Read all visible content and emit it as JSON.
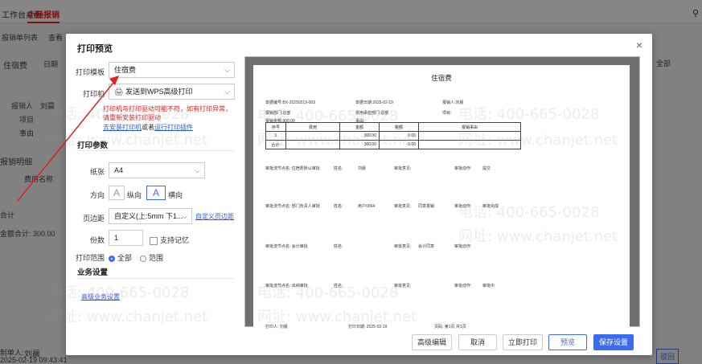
{
  "background": {
    "tabs": [
      "工作台桌面",
      "小畅报销"
    ],
    "sub_tabs": [
      "报销单列表",
      "查看"
    ],
    "left_labels": [
      "住宿费",
      "日期",
      "报销人",
      "项目",
      "事由"
    ],
    "reporter_name": "刘晨",
    "detail_heading": "报销明细",
    "detail_col_name": "费用名称",
    "detail_rows": [
      "合计"
    ],
    "total_text": "金额合计: 300.00",
    "footer_user_label": "制单人:",
    "footer_user": "刘晨",
    "footer_date": "2025-02-19 09:43:41",
    "right_btn": "驳回",
    "right_menu": "全部"
  },
  "dialog": {
    "title": "打印预览",
    "close": "×",
    "template_label": "打印模板",
    "template_value": "住宿费",
    "printer_label": "打印机",
    "printer_value": "发送到WPS高级打印",
    "error_line1": "打印机与打印驱动可能不符，如有打印异常，",
    "error_line2": "请重新安装打印驱动",
    "install_link1": "去安装打印机",
    "install_or": "或者",
    "install_link2": "运行打印插件",
    "print_params": "打印参数",
    "paper_label": "纸张",
    "paper_value": "A4",
    "orient_label": "方向",
    "portrait": "纵向",
    "landscape": "横向",
    "margin_label": "页边距",
    "margin_value": "自定义(上:5mm  下1...",
    "margin_link": "自定义页边距",
    "copies_label": "份数",
    "copies_value": "1",
    "collate": "支持记忆",
    "range_label": "打印范围",
    "range_all": "全部",
    "range_part": "范围",
    "business": "业务设置",
    "advanced_link": "高级业务设置",
    "buttons": [
      "高级编辑",
      "取消",
      "立即打印",
      "预览",
      "保存设置"
    ]
  },
  "doc": {
    "title": "住宿费",
    "no_label": "单据编号:",
    "no": "BX-20250219-003",
    "date_label": "单据日期:",
    "date": "2025-02-19",
    "person_label": "报销人:",
    "person": "刘晨",
    "dept_label": "报销部门:",
    "dept": "总部",
    "cost_dept_label": "费用承担部门:",
    "cost_dept": "总部",
    "project_label": "项目:",
    "amount_label": "报销金额:",
    "amount": "300.00",
    "reason_label": "事由:",
    "table_headers": [
      "序号",
      "费用",
      "金额",
      "税额",
      "报销事由"
    ],
    "table_rows": [
      [
        "1",
        "",
        "300.00",
        "0.00",
        ""
      ],
      [
        "合计:",
        "",
        "300.00",
        "0.00",
        ""
      ]
    ],
    "approvals": [
      {
        "node": "审批流节点名: 住宿费默认审批",
        "name": "姓名:",
        "person": "刘晨",
        "opinion": "审批意见:",
        "action": "审批动作:",
        "action_val": "提交"
      },
      {
        "node": "审批流节点名: 部门负责人审批",
        "name": "姓名:",
        "person": "用户0094",
        "opinion": "审批意见:",
        "opinion_val": "同意报销",
        "action": "审批动作:",
        "action_val": "审批完成"
      },
      {
        "node": "审批流节点名: 会计审批",
        "name": "姓名:",
        "person": "",
        "opinion": "审批意见:",
        "opinion_val": "会计同意",
        "action": "审批动作:",
        "action_val": ""
      },
      {
        "node": "审批流节点名: 出纳审批",
        "name": "姓名:",
        "person": "",
        "opinion": "审批意见:",
        "opinion_val": "",
        "action": "审批动作:",
        "action_val": "审批中"
      }
    ],
    "footer_printer": "打印人: 刘晨",
    "footer_date": "打印日期: 2025-02-19",
    "footer_page": "页码: 第1页 共1页"
  },
  "watermarks": [
    "电话: 400-665-0028",
    "网址: www.chanjet.net"
  ],
  "colors": {
    "primary": "#3b6cf0",
    "error": "#e02020",
    "active_tab": "#e02020"
  }
}
